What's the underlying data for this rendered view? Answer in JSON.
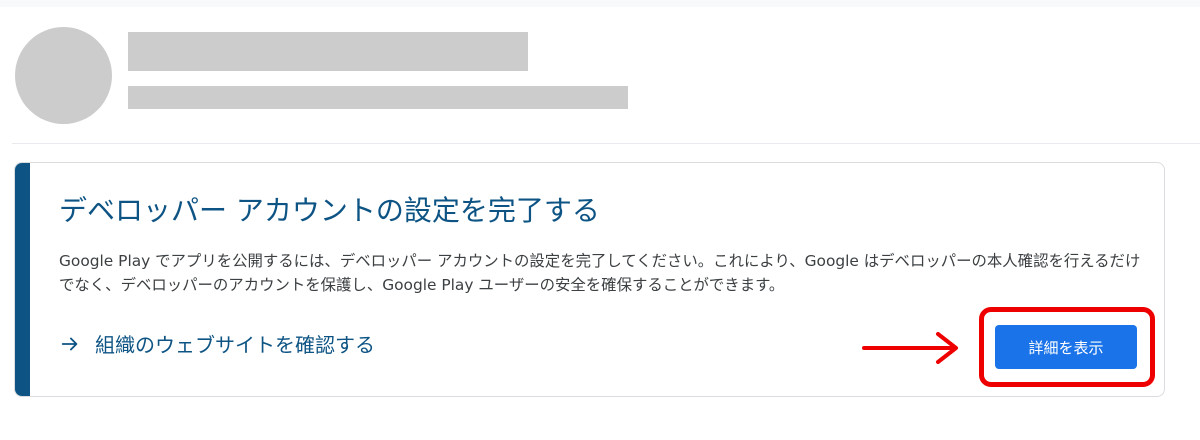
{
  "profile": {
    "avatar_color": "#cccccc",
    "name_redacted": true,
    "email_redacted": true
  },
  "card": {
    "accent_color": "#0d5484",
    "title": "デベロッパー アカウントの設定を完了する",
    "body": "Google Play でアプリを公開するには、デベロッパー アカウントの設定を完了してください。これにより、Google はデベロッパーの本人確認を行えるだけでなく、デベロッパーのアカウントを保護し、Google Play ユーザーの安全を確保することができます。",
    "link_label": "組織のウェブサイトを確認する",
    "link_icon": "arrow-right-icon",
    "button_label": "詳細を表示",
    "button_color": "#1a73e8"
  },
  "annotation": {
    "color": "#ee0000",
    "type": "highlight-with-arrow"
  }
}
